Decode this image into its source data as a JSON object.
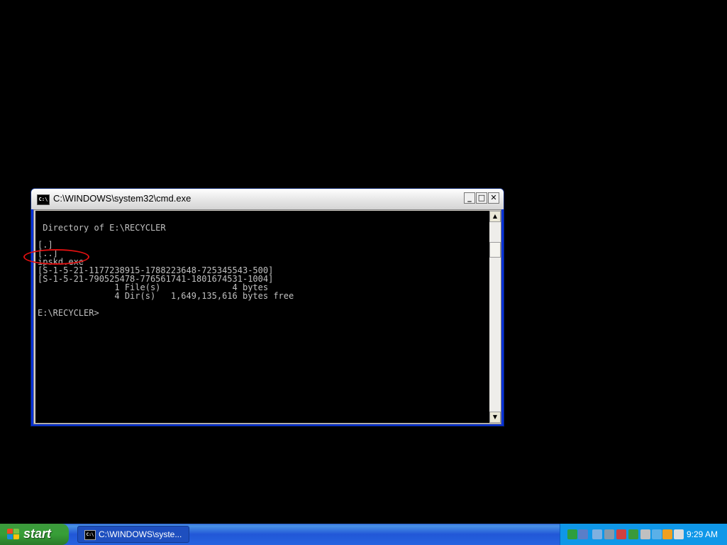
{
  "window": {
    "title": "C:\\WINDOWS\\system32\\cmd.exe",
    "icon_text": "C:\\",
    "minimize": "_",
    "maximize": "□",
    "close": "✕"
  },
  "console": {
    "lines": [
      " Directory of E:\\RECYCLER",
      "",
      "[.]",
      "[..]",
      "ipskd.exe",
      "[S-1-5-21-1177238915-1788223648-725345543-500]",
      "[S-1-5-21-790525478-776561741-1801674531-1004]",
      "               1 File(s)              4 bytes",
      "               4 Dir(s)   1,649,135,616 bytes free",
      "",
      "E:\\RECYCLER>"
    ]
  },
  "scrollbar": {
    "up": "▲",
    "down": "▼"
  },
  "annotation": {
    "color": "#e01010",
    "target": "ipskd.exe"
  },
  "taskbar": {
    "start_label": "start",
    "task_label": "C:\\WINDOWS\\syste...",
    "task_icon_text": "C:\\",
    "clock": "9:29 AM",
    "tray_icons": [
      {
        "name": "app-h-icon",
        "color": "#2e9e3e"
      },
      {
        "name": "network-icon",
        "color": "#5a7ec8"
      },
      {
        "name": "connection-icon",
        "color": "#7fb0e0"
      },
      {
        "name": "safely-remove-icon",
        "color": "#8899aa"
      },
      {
        "name": "security-icon",
        "color": "#d04040"
      },
      {
        "name": "update-icon",
        "color": "#3a9a3a"
      },
      {
        "name": "antivirus-icon",
        "color": "#e8e8e8"
      },
      {
        "name": "audio-icon",
        "color": "#c0c0c0"
      },
      {
        "name": "messenger-icon",
        "color": "#5ab0e8"
      },
      {
        "name": "media-icon",
        "color": "#f0a020"
      },
      {
        "name": "monitor-icon",
        "color": "#dcdcdc"
      }
    ]
  }
}
